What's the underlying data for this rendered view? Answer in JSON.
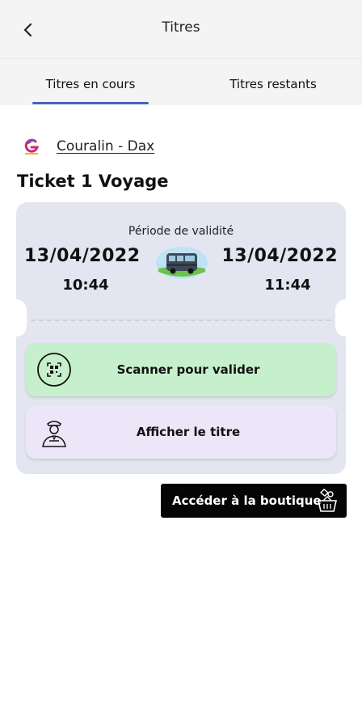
{
  "header": {
    "title": "Titres",
    "back_icon": "chevron-left-icon"
  },
  "tabs": [
    {
      "label": "Titres en cours",
      "active": true
    },
    {
      "label": "Titres restants",
      "active": false
    }
  ],
  "operator": {
    "name": "Couralin - Dax",
    "logo_icon": "couralin-logo"
  },
  "ticket": {
    "title": "Ticket 1 Voyage",
    "validity_label": "Période de validité",
    "start_date": "13/04/2022",
    "start_time": "10:44",
    "end_date": "13/04/2022",
    "end_time": "11:44",
    "transport_icon": "bus-icon"
  },
  "actions": {
    "scan_label": "Scanner pour valider",
    "scan_icon": "qr-scan-icon",
    "show_label": "Afficher le titre",
    "show_icon": "controller-person-icon"
  },
  "shop": {
    "label": "Accéder à la boutique",
    "icon": "shopping-basket-icon"
  },
  "colors": {
    "accent": "#4a63b8",
    "card_bg": "#e3e6f0",
    "scan_bg": "#c6f0cc",
    "show_bg": "#ede6f8",
    "shop_bg": "#050505"
  }
}
